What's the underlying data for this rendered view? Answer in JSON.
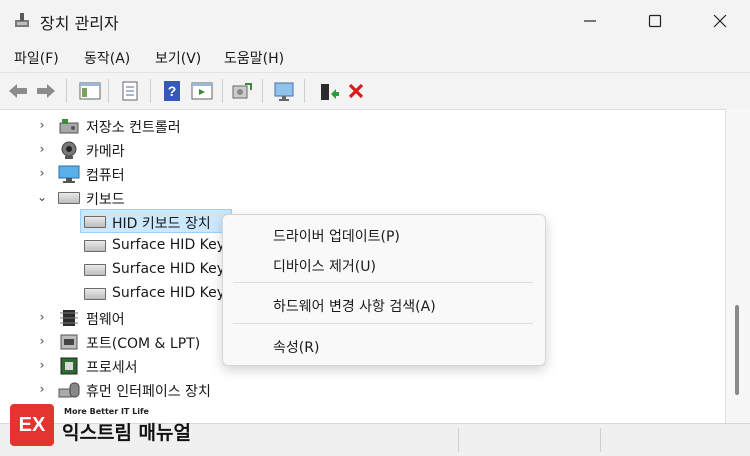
{
  "window": {
    "title": "장치 관리자"
  },
  "menu": [
    "파일(F)",
    "동작(A)",
    "보기(V)",
    "도움말(H)"
  ],
  "tree": [
    {
      "label": "저장소 컨트롤러",
      "icon": "storage-controller-icon",
      "expanded": false
    },
    {
      "label": "카메라",
      "icon": "camera-icon",
      "expanded": false
    },
    {
      "label": "컴퓨터",
      "icon": "computer-icon",
      "expanded": false
    },
    {
      "label": "키보드",
      "icon": "keyboard-icon",
      "expanded": true
    },
    {
      "label": "HID 키보드 장치",
      "icon": "keyboard-icon",
      "child": true,
      "selected": true
    },
    {
      "label": "Surface HID Key",
      "icon": "keyboard-icon",
      "child": true
    },
    {
      "label": "Surface HID Key",
      "icon": "keyboard-icon",
      "child": true
    },
    {
      "label": "Surface HID Key",
      "icon": "keyboard-icon",
      "child": true
    },
    {
      "label": "펌웨어",
      "icon": "firmware-icon",
      "expanded": false
    },
    {
      "label": "포트(COM & LPT)",
      "icon": "port-icon",
      "expanded": false
    },
    {
      "label": "프로세서",
      "icon": "processor-icon",
      "expanded": false
    },
    {
      "label": "휴먼 인터페이스 장치",
      "icon": "hid-icon",
      "expanded": false
    }
  ],
  "context_menu": {
    "update_driver": "드라이버 업데이트(P)",
    "disable_device": "디바이스 제거(U)",
    "scan_hardware": "하드웨어 변경 사항 검색(A)",
    "properties": "속성(R)"
  },
  "watermark": {
    "logo": "EX",
    "small": "More Better IT Life",
    "big": "익스트림 매뉴얼"
  }
}
